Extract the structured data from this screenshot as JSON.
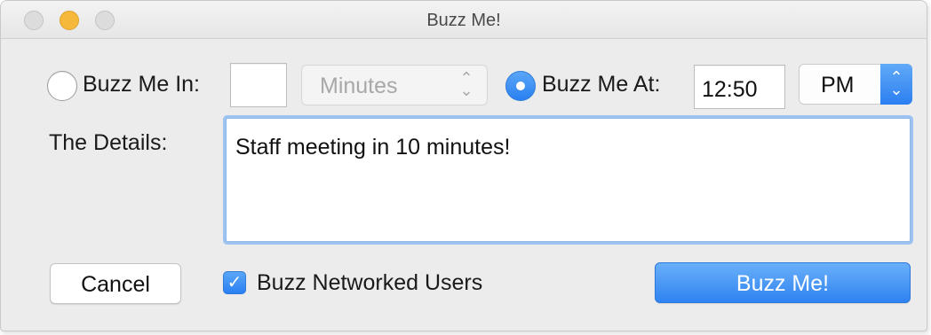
{
  "window": {
    "title": "Buzz Me!"
  },
  "buzz_in": {
    "label": "Buzz Me In:",
    "amount_value": "",
    "unit": "Minutes",
    "selected": false
  },
  "buzz_at": {
    "label": "Buzz Me At:",
    "time_value": "12:50",
    "period": "PM",
    "selected": true
  },
  "details": {
    "label": "The Details:",
    "value": "Staff meeting in 10 minutes!"
  },
  "footer": {
    "cancel_label": "Cancel",
    "networked_label": "Buzz Networked Users",
    "networked_checked": true,
    "submit_label": "Buzz Me!"
  },
  "colors": {
    "accent": "#2f84f1",
    "background": "#ececec"
  }
}
